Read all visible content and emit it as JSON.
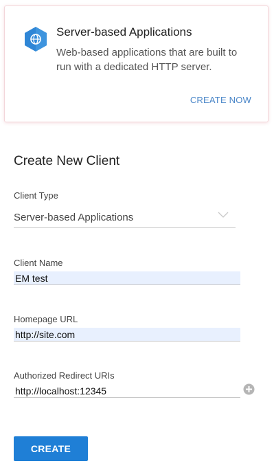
{
  "card": {
    "title": "Server-based Applications",
    "description": "Web-based applications that are built to run with a dedicated HTTP server.",
    "action": "CREATE NOW",
    "icon": "globe-icon"
  },
  "form": {
    "title": "Create New Client",
    "client_type": {
      "label": "Client Type",
      "value": "Server-based Applications"
    },
    "client_name": {
      "label": "Client Name",
      "value": "EM test"
    },
    "homepage_url": {
      "label": "Homepage URL",
      "value": "http://site.com"
    },
    "redirect_uris": {
      "label": "Authorized Redirect URIs",
      "value": "http://localhost:12345"
    },
    "submit_label": "CREATE"
  },
  "colors": {
    "accent": "#1f7fd6",
    "link": "#4a86c8",
    "autofill_bg": "#e8f0fe"
  }
}
